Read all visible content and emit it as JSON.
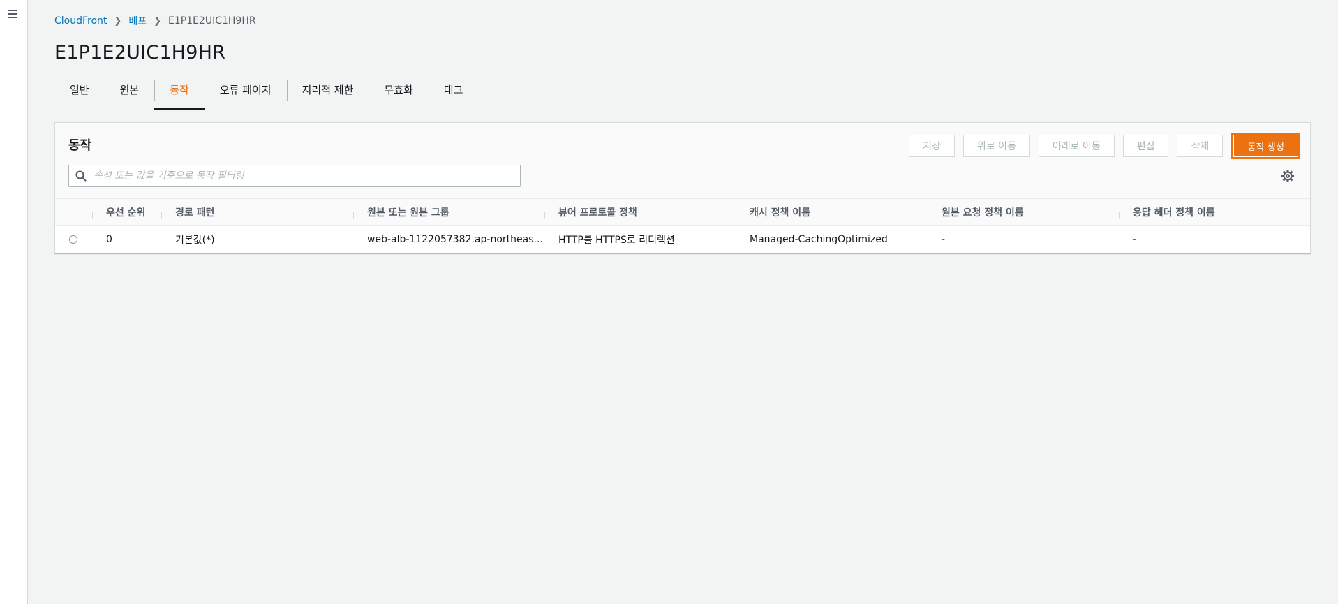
{
  "breadcrumb": {
    "items": [
      "CloudFront",
      "배포"
    ],
    "current": "E1P1E2UIC1H9HR"
  },
  "page": {
    "title": "E1P1E2UIC1H9HR"
  },
  "tabs": [
    {
      "label": "일반"
    },
    {
      "label": "원본"
    },
    {
      "label": "동작",
      "active": true
    },
    {
      "label": "오류 페이지"
    },
    {
      "label": "지리적 제한"
    },
    {
      "label": "무효화"
    },
    {
      "label": "태그"
    }
  ],
  "panel": {
    "title": "동작",
    "buttons": {
      "save": "저장",
      "move_up": "위로 이동",
      "move_down": "아래로 이동",
      "edit": "편집",
      "delete": "삭제",
      "create": "동작 생성"
    },
    "search": {
      "placeholder": "속성 또는 값을 기준으로 동작 필터링",
      "value": ""
    }
  },
  "table": {
    "columns": [
      "우선 순위",
      "경로 패턴",
      "원본 또는 원본 그룹",
      "뷰어 프로토콜 정책",
      "캐시 정책 이름",
      "원본 요청 정책 이름",
      "응답 헤더 정책 이름"
    ],
    "rows": [
      {
        "priority": "0",
        "path": "기본값(*)",
        "origin": "web-alb-1122057382.ap-northeas...",
        "viewer_protocol": "HTTP를 HTTPS로 리디렉션",
        "cache_policy": "Managed-CachingOptimized",
        "origin_request_policy": "-",
        "response_headers_policy": "-"
      }
    ]
  },
  "colors": {
    "accent": "#ec7211",
    "link": "#0073bb"
  },
  "icons": {
    "menu": "menu-icon",
    "search": "search-icon",
    "settings": "gear-icon",
    "separator": "chevron-right-icon"
  }
}
